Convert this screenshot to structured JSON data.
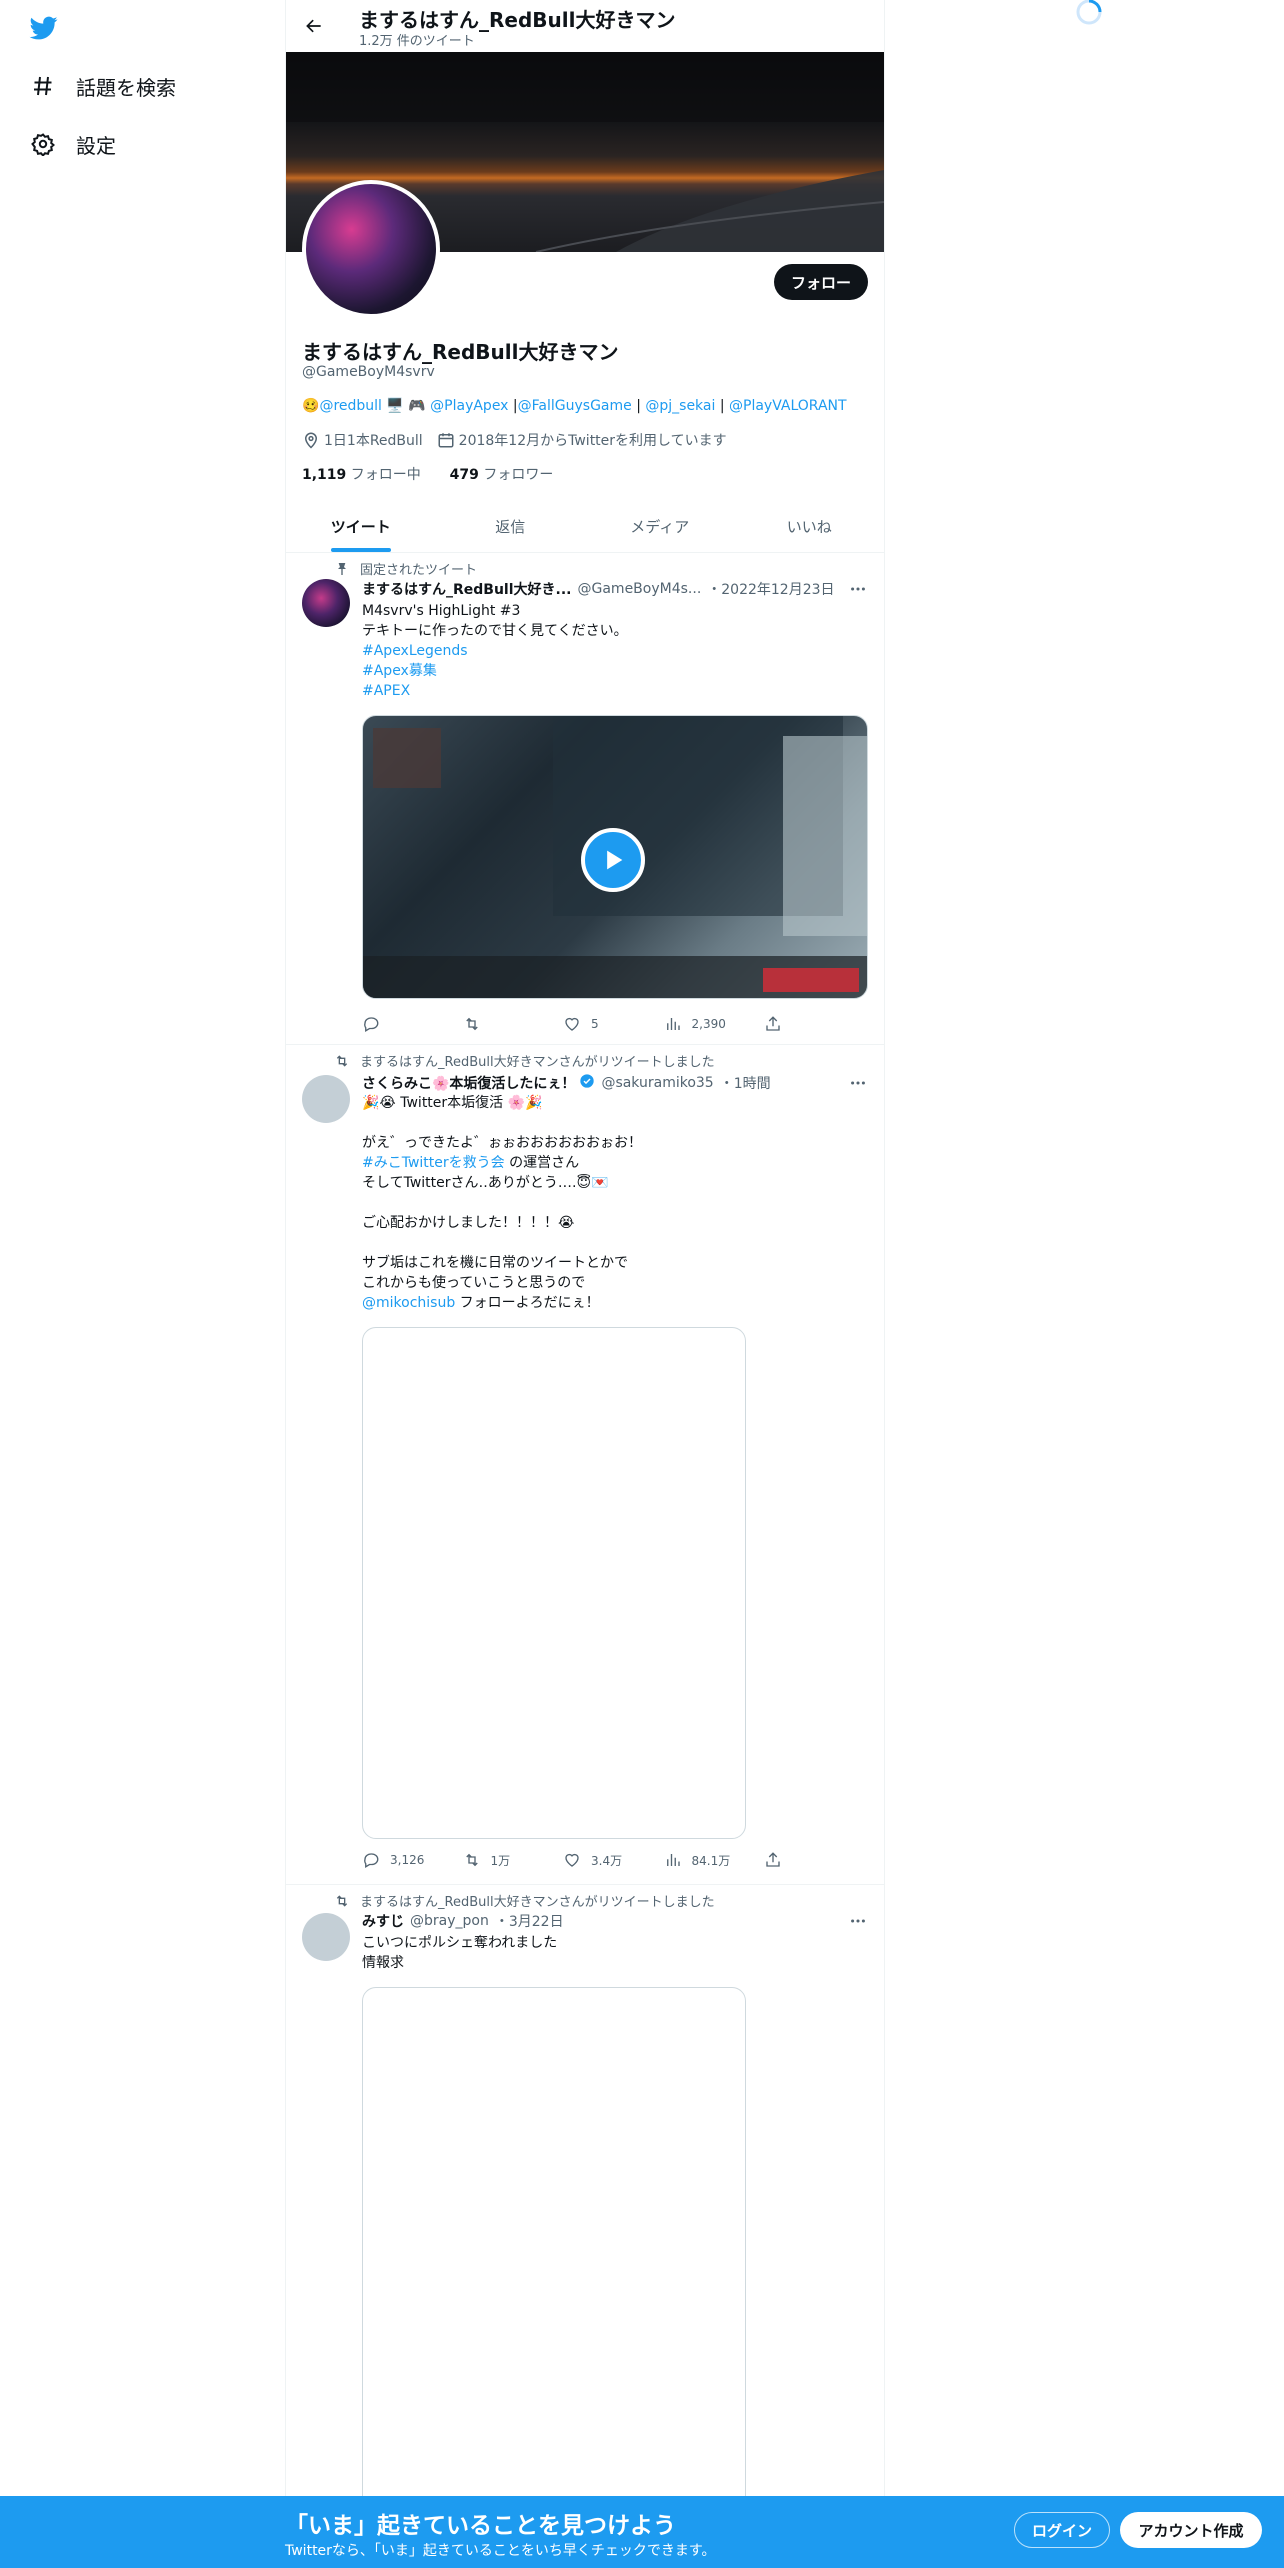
{
  "nav": {
    "items": [
      {
        "label": "話題を検索",
        "icon": "hashtag-icon"
      },
      {
        "label": "設定",
        "icon": "gear-icon"
      }
    ]
  },
  "header": {
    "title": "まするはすん_RedBull大好きマン",
    "tweet_count": "1.2万 件のツイート"
  },
  "profile": {
    "name": "まするはすん_RedBull大好きマン",
    "handle": "@GameBoyM4svrv",
    "follow_label": "フォロー",
    "bio": {
      "emoji1": "🥴",
      "link1": "@redbull",
      "emoji2": " 🖥️ 🎮 ",
      "link2": "@PlayApex",
      "sep1": " |",
      "link3": "@FallGuysGame",
      "sep2": " | ",
      "link4": "@pj_sekai",
      "sep3": " | ",
      "link5": "@PlayVALORANT"
    },
    "location": "1日1本RedBull",
    "joined": "2018年12月からTwitterを利用しています",
    "following_count": "1,119",
    "following_label": " フォロー中",
    "followers_count": "479",
    "followers_label": " フォロワー"
  },
  "tabs": [
    "ツイート",
    "返信",
    "メディア",
    "いいね"
  ],
  "tweets": [
    {
      "context": "固定されたツイート",
      "name": "まするはすん_RedBull大好き...",
      "handle": "@GameBoyM4s...",
      "date": "・2022年12月23日",
      "lines": [
        "M4svrv's HighLight #3",
        "テキトーに作ったので甘く見てください。",
        " #ApexLegends",
        " #Apex募集",
        "#APEX"
      ],
      "stats": {
        "replies": "",
        "retweets": "",
        "likes": "5",
        "views": "2,390"
      }
    },
    {
      "context": "まするはすん_RedBull大好きマンさんがリツイートしました",
      "name": "さくらみこ🌸本垢復活したにぇ！",
      "handle": "@sakuramiko35",
      "date": "・1時間",
      "lines": [
        "🎉😭 Twitter本垢復活 🌸🎉",
        "",
        "がえ゛っできたよ゛ぉぉおおおおおおぉお！",
        "",
        "そしてTwitterさん‥ありがとう‥‥😇💌",
        "",
        "ご心配おかけしました！！！！😭",
        "",
        "サブ垢はこれを機に日常のツイートとかで",
        "これからも使っていこうと思うので",
        ""
      ],
      "hashtag_line": {
        "tag": "#みこTwitterを救う会",
        "rest": " の運営さん"
      },
      "mention_line": {
        "mention": "@mikochisub",
        "rest": " フォローよろだにぇ！"
      },
      "stats": {
        "replies": "3,126",
        "retweets": "1万",
        "likes": "3.4万",
        "views": "84.1万"
      }
    },
    {
      "context": "まするはすん_RedBull大好きマンさんがリツイートしました",
      "name": "みすじ",
      "handle": "@bray_pon",
      "date": "・3月22日",
      "lines": [
        "こいつにポルシェ奪われました",
        "情報求"
      ]
    }
  ],
  "bottom_bar": {
    "title": "「いま」起きていることを見つけよう",
    "subtitle": "Twitterなら、「いま」起きていることをいち早くチェックできます。",
    "login_label": "ログイン",
    "signup_label": "アカウント作成"
  },
  "colors": {
    "accent": "#1d9bf0",
    "text": "#0f1419",
    "muted": "#536471"
  }
}
